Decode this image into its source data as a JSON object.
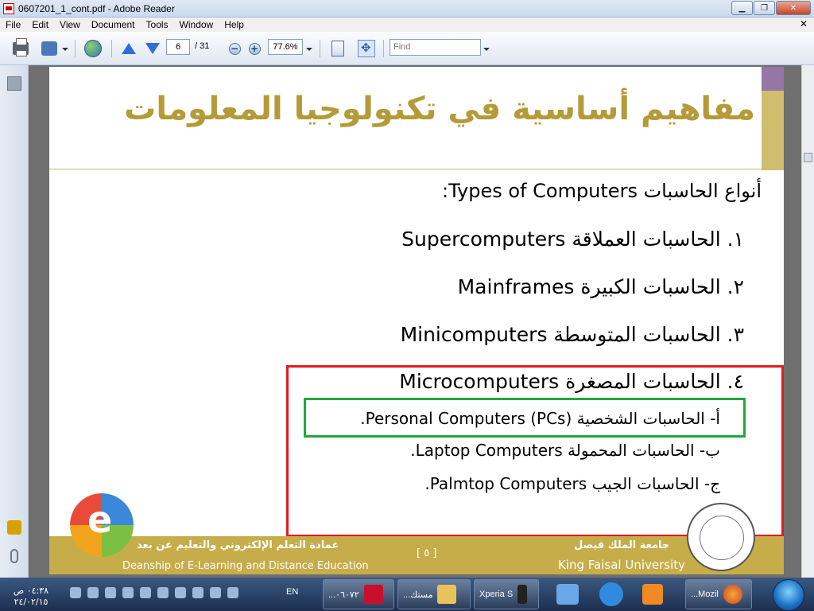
{
  "window": {
    "title": "0607201_1_cont.pdf - Adobe Reader"
  },
  "menu": {
    "items": [
      "File",
      "Edit",
      "View",
      "Document",
      "Tools",
      "Window",
      "Help"
    ]
  },
  "toolbar": {
    "page_current": "6",
    "page_total": "/ 31",
    "zoom": "77.6%",
    "find_placeholder": "Find"
  },
  "slide": {
    "title": "مفاهيم أساسية في تكنولوجيا المعلومات",
    "heading": "أنواع الحاسبات Types of Computers:",
    "items": [
      "١.  الحاسبات العملاقة Supercomputers",
      "٢.  الحاسبات الكبيرة Mainframes",
      "٣.  الحاسبات المتوسطة Minicomputers",
      "٤.  الحاسبات المصغرة Microcomputers"
    ],
    "subitems": [
      "أ-   الحاسبات الشخصية (Personal Computers (PCs.",
      "ب-  الحاسبات المحمولة Laptop Computers.",
      "ج-  الحاسبات الجيب Palmtop Computers."
    ],
    "footer": {
      "deanship_ar": "عمادة التعلم الإلكتروني والتعليم عن بعد",
      "deanship_en": "Deanship of E-Learning and Distance Education",
      "page": "[ ٥ ]",
      "university_ar": "جامعة الملك فيصل",
      "university_en": "King Faisal University"
    }
  },
  "taskbar": {
    "clock_time": "٠٤:٣٨ ص",
    "clock_date": "٢٤/٠٢/١٥",
    "lang": "EN",
    "buttons": [
      "...٠٦٠٧٢",
      "...مستك",
      "Xperia S",
      "...Mozil"
    ]
  }
}
